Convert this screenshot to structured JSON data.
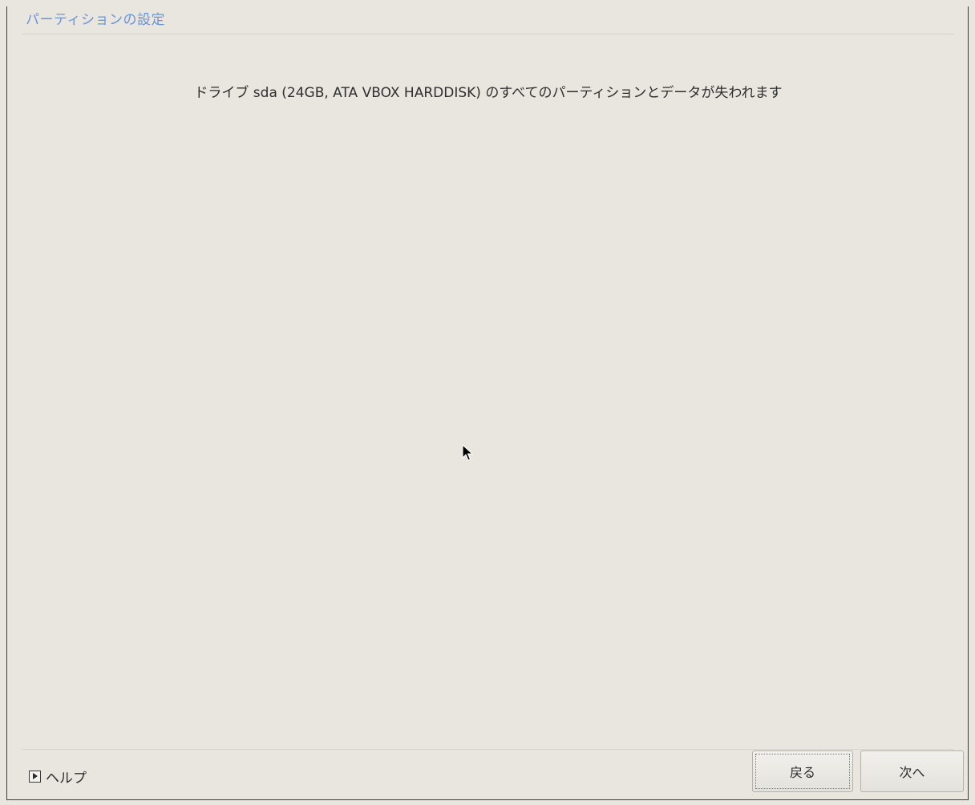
{
  "window": {
    "title": "パーティションの設定"
  },
  "main": {
    "message": "ドライブ sda (24GB, ATA VBOX HARDDISK) のすべてのパーティションとデータが失われます"
  },
  "footer": {
    "help_label": "ヘルプ",
    "help_icon": "expander-arrow-icon",
    "back_label": "戻る",
    "next_label": "次へ"
  },
  "colors": {
    "background": "#e8e6df",
    "title": "#6b94d6",
    "text": "#2e2e2e"
  }
}
